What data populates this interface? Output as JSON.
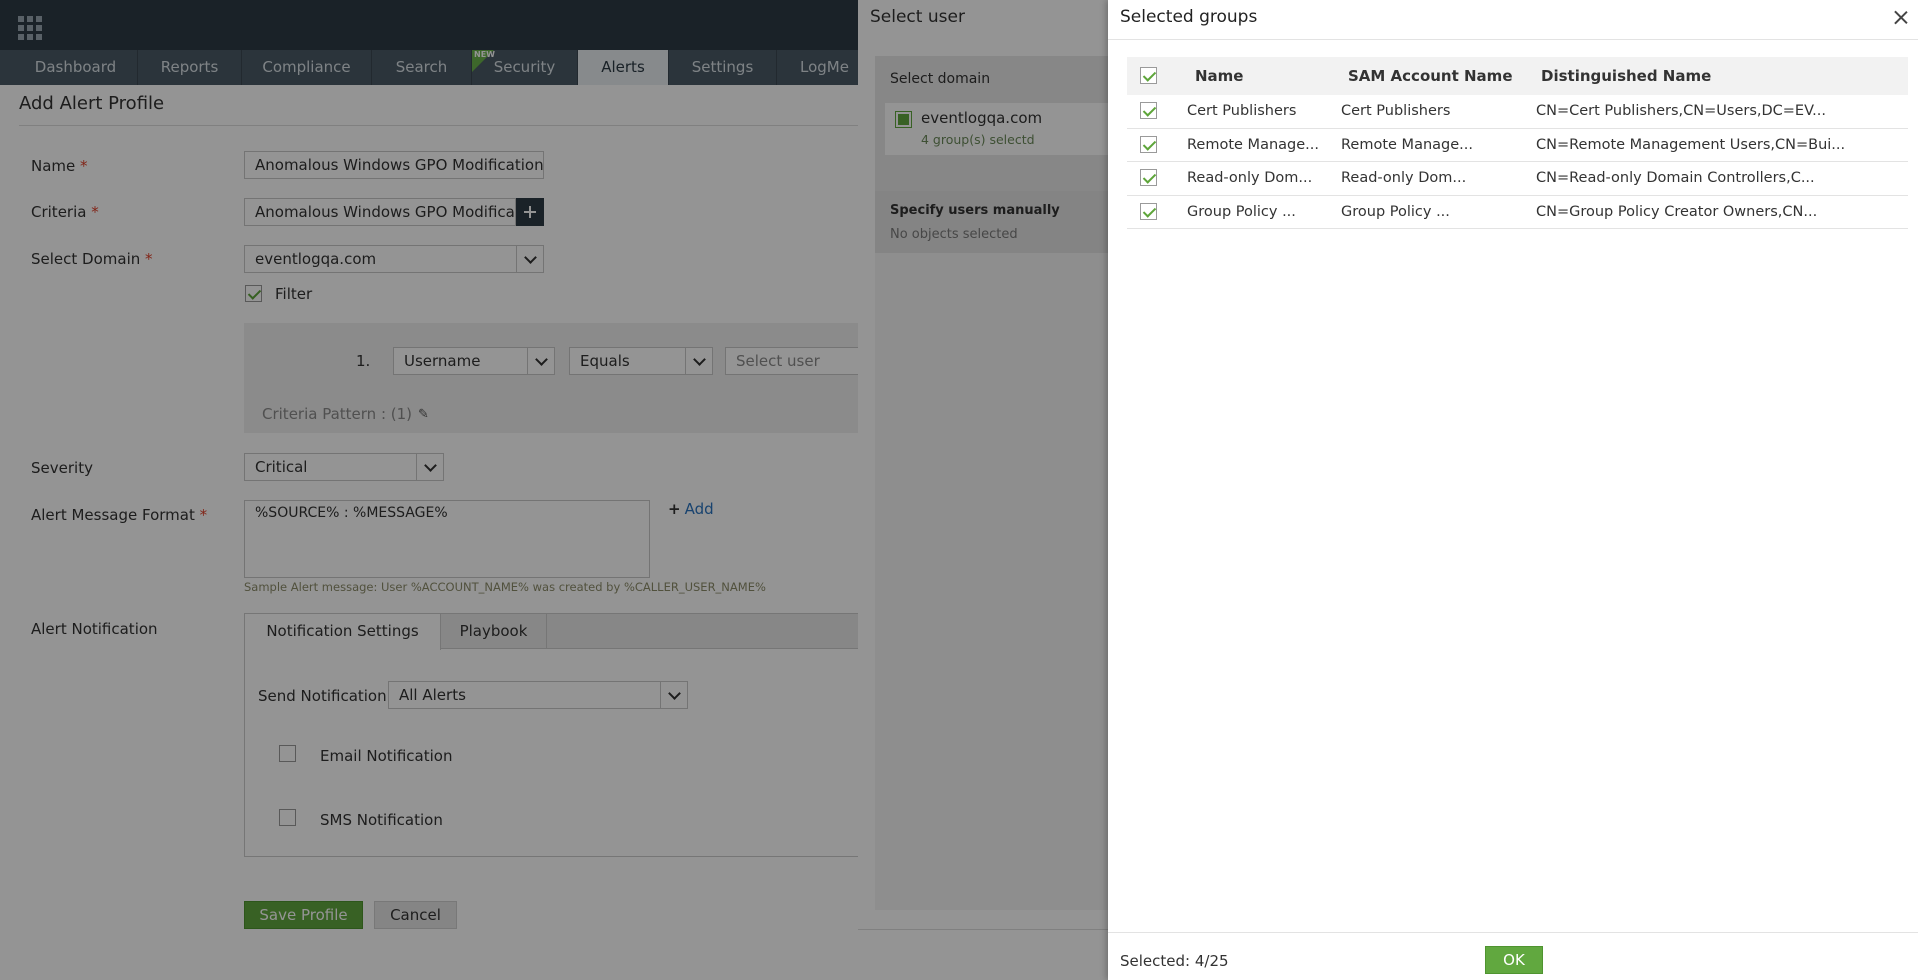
{
  "nav": {
    "tabs": [
      "Dashboard",
      "Reports",
      "Compliance",
      "Search",
      "Security",
      "Alerts",
      "Settings",
      "LogMe"
    ],
    "active": "Alerts",
    "new_badge": "NEW"
  },
  "form": {
    "title": "Add Alert Profile",
    "name_label": "Name",
    "name_value": "Anomalous Windows GPO Modification",
    "criteria_label": "Criteria",
    "criteria_value": "Anomalous Windows GPO Modification",
    "domain_label": "Select Domain",
    "domain_value": "eventlogqa.com",
    "filter_label": "Filter",
    "filter_checked": true,
    "filter_row": {
      "index": "1.",
      "field": "Username",
      "operator": "Equals",
      "value_placeholder": "Select user"
    },
    "criteria_pattern": "Criteria Pattern : (1)",
    "severity_label": "Severity",
    "severity_value": "Critical",
    "message_label": "Alert Message Format",
    "message_value": "%SOURCE% : %MESSAGE%",
    "add_label": "Add",
    "sample_message": "Sample Alert message: User %ACCOUNT_NAME% was created by %CALLER_USER_NAME%",
    "notification_label": "Alert Notification",
    "notif_tabs": [
      "Notification Settings",
      "Playbook"
    ],
    "send_notification_label": "Send Notification",
    "send_notification_value": "All Alerts",
    "email_label": "Email Notification",
    "sms_label": "SMS Notification",
    "save_label": "Save Profile",
    "cancel_label": "Cancel",
    "required_mark": "*"
  },
  "select_user": {
    "title": "Select user",
    "domain_label": "Select domain",
    "domain_name": "eventlogqa.com",
    "domain_count": "4 group(s) selectd",
    "manual_label": "Specify users manually",
    "manual_empty": "No objects selected"
  },
  "selected_groups": {
    "title": "Selected groups",
    "columns": [
      "Name",
      "SAM Account Name",
      "Distinguished Name"
    ],
    "rows": [
      {
        "name": "Cert Publishers",
        "sam": "Cert Publishers",
        "dn": "CN=Cert Publishers,CN=Users,DC=EV..."
      },
      {
        "name": "Remote Manage...",
        "sam": "Remote Manage...",
        "dn": "CN=Remote Management Users,CN=Bui..."
      },
      {
        "name": "Read-only Dom...",
        "sam": "Read-only Dom...",
        "dn": "CN=Read-only Domain Controllers,C..."
      },
      {
        "name": "Group Policy ...",
        "sam": "Group Policy ...",
        "dn": "CN=Group Policy Creator Owners,CN..."
      }
    ],
    "selected_text": "Selected: 4/25",
    "ok_label": "OK"
  }
}
